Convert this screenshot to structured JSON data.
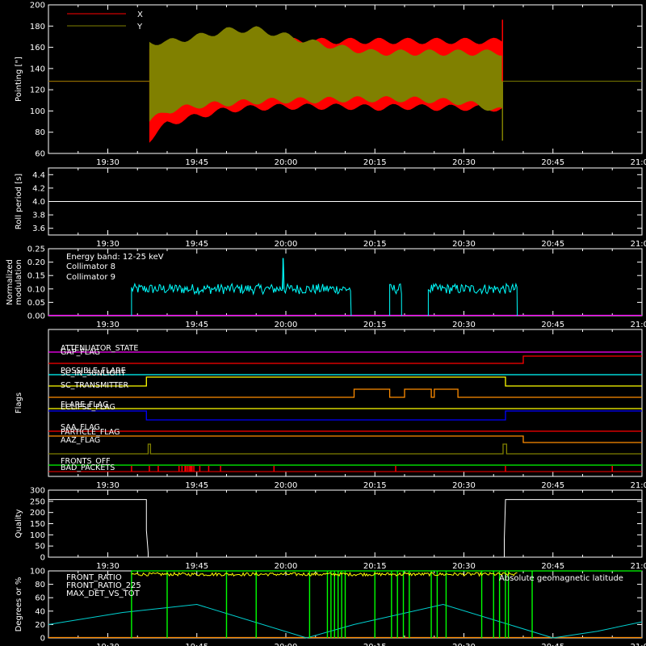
{
  "colors": {
    "background": "#000000",
    "axis": "#ffffff",
    "pointing_x": "#ff0000",
    "pointing_y": "#808000",
    "collimator_8": "#00ffff",
    "collimator_9": "#ff00ff",
    "front_ratio": "#ffff00",
    "front_ratio_225": "#00ff00",
    "max_det_vs_tot": "#ff8c00",
    "geomag_latitude": "#00d0d0"
  },
  "time_axis": {
    "tick_labels": [
      "19:30",
      "19:45",
      "20:00",
      "20:15",
      "20:30",
      "20:45",
      "21:00"
    ],
    "tick_minutes": [
      -30,
      -15,
      0,
      15,
      30,
      45,
      60
    ],
    "range_minutes": [
      -40,
      60
    ]
  },
  "chart_data": [
    {
      "id": "pointing",
      "type": "area",
      "ylabel": "Pointing [\"]",
      "ylim": [
        60,
        200
      ],
      "yticks": [
        60,
        80,
        100,
        120,
        140,
        160,
        180,
        200
      ],
      "legend_position": "top-left",
      "series": [
        {
          "name": "X",
          "envelope_upper": [
            [
              -23,
              155
            ],
            [
              -20,
              160
            ],
            [
              -15,
              165
            ],
            [
              -10,
              168
            ],
            [
              -5,
              168
            ],
            [
              0,
              166
            ],
            [
              5,
              166
            ],
            [
              10,
              166
            ],
            [
              15,
              166
            ],
            [
              20,
              166
            ],
            [
              25,
              166
            ],
            [
              30,
              166
            ],
            [
              36.5,
              166
            ]
          ],
          "envelope_lower": [
            [
              -23,
              73
            ],
            [
              -20,
              88
            ],
            [
              -15,
              95
            ],
            [
              -10,
              101
            ],
            [
              -5,
              103
            ],
            [
              0,
              104
            ],
            [
              5,
              104
            ],
            [
              10,
              104
            ],
            [
              15,
              103
            ],
            [
              20,
              104
            ],
            [
              25,
              103
            ],
            [
              30,
              103
            ],
            [
              36.5,
              102
            ]
          ],
          "baseline": 128
        },
        {
          "name": "Y",
          "envelope_upper": [
            [
              -23,
              165
            ],
            [
              -20,
              165
            ],
            [
              -15,
              170
            ],
            [
              -10,
              176
            ],
            [
              -5,
              177
            ],
            [
              0,
              171
            ],
            [
              5,
              164
            ],
            [
              10,
              159
            ],
            [
              15,
              155
            ],
            [
              20,
              155
            ],
            [
              25,
              155
            ],
            [
              30,
              155
            ],
            [
              36.5,
              155
            ]
          ],
          "envelope_lower": [
            [
              -23,
              90
            ],
            [
              -20,
              100
            ],
            [
              -15,
              105
            ],
            [
              -10,
              107
            ],
            [
              -5,
              109
            ],
            [
              0,
              110
            ],
            [
              5,
              110
            ],
            [
              10,
              111
            ],
            [
              15,
              111
            ],
            [
              20,
              111
            ],
            [
              25,
              110
            ],
            [
              30,
              108
            ],
            [
              36.5,
              100
            ]
          ],
          "baseline": 128
        }
      ]
    },
    {
      "id": "roll_period",
      "type": "line",
      "ylabel": "Roll period [s]",
      "ylim": [
        3.5,
        4.5
      ],
      "yticks": [
        3.6,
        3.8,
        4.0,
        4.2,
        4.4
      ],
      "series": [
        {
          "name": "",
          "x": [
            -40,
            60
          ],
          "y": [
            4.0,
            4.0
          ]
        }
      ]
    },
    {
      "id": "modulation",
      "type": "line",
      "ylabel": "Normalized modulation",
      "ylim": [
        0,
        0.25
      ],
      "yticks": [
        0.0,
        0.05,
        0.1,
        0.15,
        0.2,
        0.25
      ],
      "annotation": "Energy band: 12-25 keV",
      "legend_position": "top-left",
      "series": [
        {
          "name": "Collimator 8",
          "segments": [
            [
              -26,
              11
            ],
            [
              17.5,
              19.5
            ],
            [
              24,
              39
            ]
          ],
          "mean": 0.1,
          "noise": 0.012,
          "spike": {
            "x": -0.5,
            "y": 0.215
          }
        },
        {
          "name": "Collimator 9",
          "x": [
            -40,
            60
          ],
          "y": [
            0,
            0
          ]
        }
      ]
    },
    {
      "id": "flags",
      "type": "line",
      "ylabel": "Flags",
      "series": [
        {
          "name": "ATTENUATOR_STATE",
          "color": "#ff00ff",
          "levels": [
            [
              -40,
              0
            ],
            [
              60,
              0
            ]
          ]
        },
        {
          "name": "GAP_FLAG",
          "color": "#ff0000",
          "levels": [
            [
              -40,
              0
            ],
            [
              40,
              0
            ],
            [
              40,
              1
            ],
            [
              60,
              1
            ]
          ]
        },
        {
          "name": "POSSIBLE_FLARE",
          "color": "#00ffff",
          "levels": [
            [
              -40,
              0
            ],
            [
              60,
              0
            ]
          ]
        },
        {
          "name": "SC_IN_SUNLIGHT",
          "color": "#ffff00",
          "levels": [
            [
              -40,
              0
            ],
            [
              -23.5,
              0
            ],
            [
              -23.5,
              1
            ],
            [
              37,
              1
            ],
            [
              37,
              0
            ],
            [
              60,
              0
            ]
          ]
        },
        {
          "name": "SC_TRANSMITTER",
          "color": "#ff8c00",
          "levels": [
            [
              -40,
              0
            ],
            [
              11.5,
              0
            ],
            [
              11.5,
              1
            ],
            [
              17.5,
              1
            ],
            [
              17.5,
              0
            ],
            [
              20,
              0
            ],
            [
              20,
              1
            ],
            [
              24.5,
              1
            ],
            [
              24.5,
              0
            ],
            [
              25,
              0
            ],
            [
              25,
              1
            ],
            [
              29,
              1
            ],
            [
              29,
              0
            ],
            [
              60,
              0
            ]
          ]
        },
        {
          "name": "FLARE_FLAG",
          "color": "#ffff00",
          "levels": [
            [
              -40,
              0
            ],
            [
              60,
              0
            ]
          ]
        },
        {
          "name": "ECLIPSE_FLAG",
          "color": "#0000ff",
          "levels": [
            [
              -40,
              1
            ],
            [
              -23.5,
              1
            ],
            [
              -23.5,
              0
            ],
            [
              37,
              0
            ],
            [
              37,
              1
            ],
            [
              60,
              1
            ]
          ]
        },
        {
          "name": "SAA_FLAG",
          "color": "#ff0000",
          "levels": [
            [
              -40,
              0
            ],
            [
              60,
              0
            ]
          ]
        },
        {
          "name": "PARTICLE_FLAG",
          "color": "#ff8c00",
          "levels": [
            [
              -40,
              1
            ],
            [
              40,
              1
            ],
            [
              40,
              0
            ],
            [
              60,
              0
            ]
          ]
        },
        {
          "name": "AAZ_FLAG",
          "color": "#808000",
          "levels": [
            [
              -40,
              0
            ],
            [
              -23.2,
              0
            ],
            [
              -23.2,
              1
            ],
            [
              -22.8,
              1
            ],
            [
              -22.8,
              0
            ],
            [
              36.6,
              0
            ],
            [
              36.6,
              1
            ],
            [
              37.2,
              1
            ],
            [
              37.2,
              0
            ],
            [
              60,
              0
            ]
          ]
        },
        {
          "name": "FRONTS_OFF",
          "color": "#00ff00",
          "levels": [
            [
              -40,
              0
            ],
            [
              60,
              0
            ]
          ]
        },
        {
          "name": "BAD_PACKETS",
          "color": "#ff0000",
          "spikes": [
            -26,
            -23,
            -21.5,
            -18,
            -17.5,
            -17,
            -16.8,
            -16.5,
            -16.2,
            -16,
            -15.8,
            -15.5,
            -14.5,
            -13,
            -11,
            -2,
            18.5,
            37,
            55
          ]
        }
      ]
    },
    {
      "id": "quality",
      "type": "line",
      "ylabel": "Quality",
      "ylim": [
        0,
        300
      ],
      "yticks": [
        0,
        50,
        100,
        150,
        200,
        250,
        300
      ],
      "series": [
        {
          "name": "",
          "x": [
            -40,
            -23.5,
            -23.5,
            -23.2,
            -23.2,
            36.8,
            36.8,
            37,
            60
          ],
          "y": [
            258,
            258,
            120,
            20,
            0,
            0,
            80,
            258,
            258
          ]
        }
      ]
    },
    {
      "id": "ratios",
      "type": "line",
      "ylabel": "Degrees or %",
      "ylim": [
        0,
        100
      ],
      "yticks": [
        0,
        20,
        40,
        60,
        80,
        100
      ],
      "legend_position": "top-left",
      "series": [
        {
          "name": "FRONT_RATIO",
          "level": 95,
          "noise": 2.5
        },
        {
          "name": "FRONT_RATIO_225",
          "level": 100,
          "drops": [
            -26,
            -20,
            -10,
            -5,
            4,
            7,
            7.6,
            8.2,
            8.8,
            9.4,
            10,
            15,
            17.8,
            18.8,
            19.8,
            20.8,
            24.5,
            25.5,
            27,
            33,
            35,
            36,
            37,
            37.5,
            41.5
          ]
        },
        {
          "name": "MAX_DET_VS_TOT",
          "level": 0
        },
        {
          "name": "Absolute geomagnetic latitude",
          "x": [
            -40,
            -27.5,
            -15,
            3.5,
            11.5,
            26.5,
            45,
            52.5,
            60
          ],
          "y": [
            20,
            38,
            50,
            0,
            20,
            50,
            0,
            10,
            24
          ]
        }
      ]
    }
  ]
}
